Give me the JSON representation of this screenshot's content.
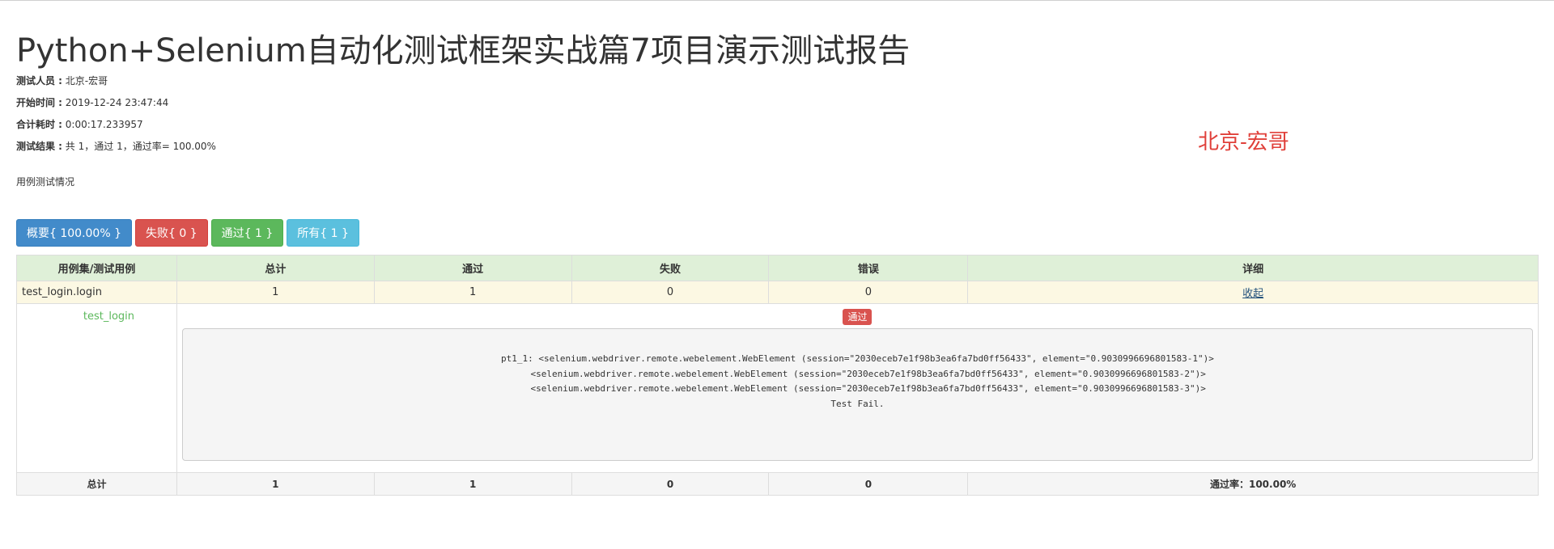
{
  "page_title": "Python+Selenium自动化测试框架实战篇7项目演示测试报告",
  "meta": {
    "tester_label": "测试人员 :",
    "tester_value": " 北京-宏哥",
    "start_label": "开始时间 :",
    "start_value": " 2019-12-24 23:47:44",
    "duration_label": "合计耗时 :",
    "duration_value": " 0:00:17.233957",
    "result_label": "测试结果 :",
    "result_value": " 共 1，通过 1，通过率= 100.00%"
  },
  "watermark": "北京-宏哥",
  "subtitle": "用例测试情况",
  "filter_buttons": {
    "summary": "概要{ 100.00% }",
    "failed": "失败{ 0 }",
    "passed": "通过{ 1 }",
    "all": "所有{ 1 }"
  },
  "colors": {
    "primary": "#428bca",
    "danger": "#d9534f",
    "success": "#5cb85c",
    "info": "#5bc0de",
    "header_bg": "#dff0d8",
    "suite_bg": "#fcf8e3"
  },
  "table": {
    "headers": [
      "用例集/测试用例",
      "总计",
      "通过",
      "失败",
      "错误",
      "详细"
    ],
    "suite": {
      "name": "test_login.login",
      "total": "1",
      "passed": "1",
      "failed": "0",
      "errors": "0",
      "detail_link": "收起"
    },
    "case": {
      "name": "test_login",
      "status_badge": "通过",
      "log": "pt1_1: <selenium.webdriver.remote.webelement.WebElement (session=\"2030eceb7e1f98b3ea6fa7bd0ff56433\", element=\"0.9030996696801583-1\")>\n    <selenium.webdriver.remote.webelement.WebElement (session=\"2030eceb7e1f98b3ea6fa7bd0ff56433\", element=\"0.9030996696801583-2\")>\n    <selenium.webdriver.remote.webelement.WebElement (session=\"2030eceb7e1f98b3ea6fa7bd0ff56433\", element=\"0.9030996696801583-3\")>\nTest Fail."
    },
    "total": {
      "label": "总计",
      "total": "1",
      "passed": "1",
      "failed": "0",
      "errors": "0",
      "pass_rate": "通过率：100.00%"
    }
  }
}
